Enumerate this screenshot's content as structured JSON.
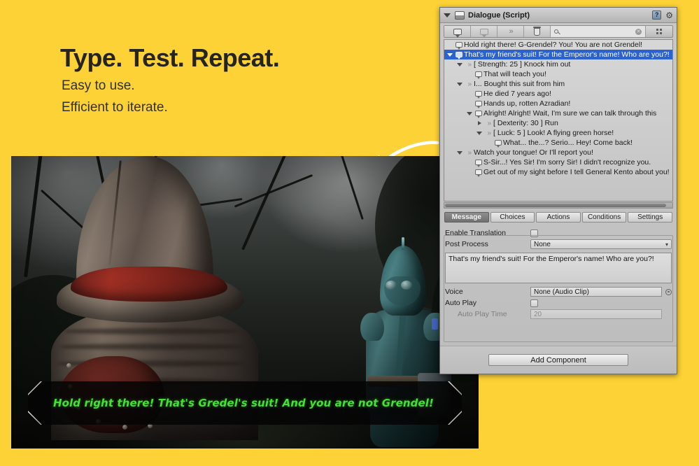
{
  "theme": {
    "background": "#fcd236",
    "accent_green": "#45e034",
    "selection_blue": "#2a62d0"
  },
  "marketing": {
    "headline": "Type. Test. Repeat.",
    "sub_line_1": "Easy to use.",
    "sub_line_2": "Efficient to iterate."
  },
  "game": {
    "subtitle": "Hold right there! That's Gredel's suit! And you are not Grendel!"
  },
  "inspector": {
    "title": "Dialogue (Script)",
    "help_glyph": "?",
    "gear_glyph": "⚙",
    "toolbar": {
      "add_node_label": "add-node",
      "add_sibling_label": "add-sibling",
      "move_label": "move",
      "delete_label": "delete",
      "search_value": "",
      "search_placeholder": "",
      "grid_label": "layout"
    },
    "tree": [
      {
        "depth": 0,
        "twisty": "none",
        "icon": "bubble",
        "text": "Hold right there! G-Grendel? You! You are not Grendel!",
        "selected": false
      },
      {
        "depth": 0,
        "twisty": "down",
        "icon": "bubble",
        "text": "That's my friend's suit! For the Emperor's name! Who are you?!",
        "selected": true
      },
      {
        "depth": 1,
        "twisty": "down",
        "icon": "chev",
        "text": "[ Strength: 25 ] Knock him out",
        "selected": false
      },
      {
        "depth": 2,
        "twisty": "none",
        "icon": "bubble",
        "text": "That will teach you!",
        "selected": false
      },
      {
        "depth": 1,
        "twisty": "down",
        "icon": "chev",
        "text": "I... Bought this suit from him",
        "selected": false
      },
      {
        "depth": 2,
        "twisty": "none",
        "icon": "bubble",
        "text": "He died 7 years ago!",
        "selected": false
      },
      {
        "depth": 2,
        "twisty": "none",
        "icon": "bubble",
        "text": "Hands up, rotten Azradian!",
        "selected": false
      },
      {
        "depth": 2,
        "twisty": "down",
        "icon": "bubble",
        "text": "Alright! Alright! Wait, I'm sure we can talk through this",
        "selected": false
      },
      {
        "depth": 3,
        "twisty": "right",
        "icon": "chev",
        "text": "[ Dexterity: 30 ] Run",
        "selected": false
      },
      {
        "depth": 3,
        "twisty": "down",
        "icon": "chev",
        "text": "[ Luck: 5 ] Look! A flying green horse!",
        "selected": false
      },
      {
        "depth": 4,
        "twisty": "none",
        "icon": "bubble",
        "text": "What... the...? Serio... Hey! Come back!",
        "selected": false
      },
      {
        "depth": 1,
        "twisty": "down",
        "icon": "chev",
        "text": "Watch your tongue! Or I'll report you!",
        "selected": false
      },
      {
        "depth": 2,
        "twisty": "none",
        "icon": "bubble",
        "text": "S-Sir...! Yes Sir! I'm sorry Sir! I didn't recognize you.",
        "selected": false
      },
      {
        "depth": 2,
        "twisty": "none",
        "icon": "bubble",
        "text": "Get out of my sight before I tell General Kento about you!",
        "selected": false
      }
    ],
    "tabs": [
      {
        "label": "Message",
        "active": true
      },
      {
        "label": "Choices",
        "active": false
      },
      {
        "label": "Actions",
        "active": false
      },
      {
        "label": "Conditions",
        "active": false
      },
      {
        "label": "Settings",
        "active": false
      }
    ],
    "properties": {
      "enable_translation_label": "Enable Translation",
      "enable_translation_checked": false,
      "post_process_label": "Post Process",
      "post_process_value": "None",
      "message_text": "That's my friend's suit! For the Emperor's name! Who are you?!",
      "voice_label": "Voice",
      "voice_value": "None (Audio Clip)",
      "auto_play_label": "Auto Play",
      "auto_play_checked": false,
      "auto_play_time_label": "Auto Play Time",
      "auto_play_time_value": "20"
    },
    "add_component_label": "Add Component"
  }
}
